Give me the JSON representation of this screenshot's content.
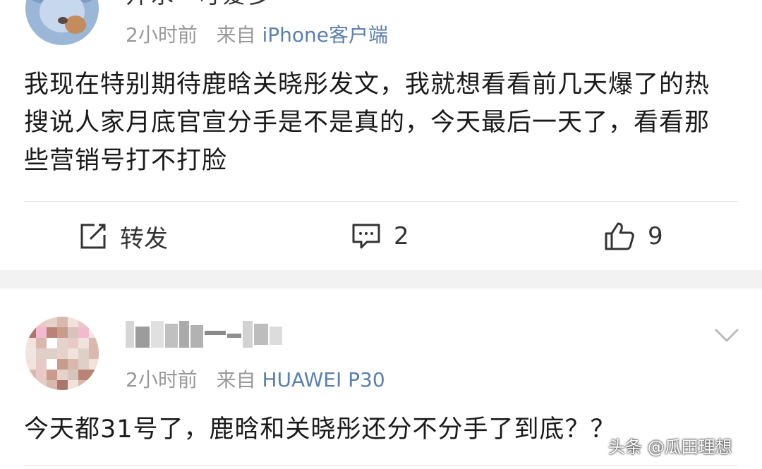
{
  "post1": {
    "username": "开水 -可爱多",
    "time": "2小时前",
    "from_label": "来自",
    "source": "iPhone客户端",
    "text": "我现在特别期待鹿晗关晓彤发文，我就想看看前几天爆了的热搜说人家月底官宣分手是不是真的，今天最后一天了，看看那些营销号打不打脸",
    "actions": {
      "repost_label": "转发",
      "comment_count": "2",
      "like_count": "9"
    }
  },
  "post2": {
    "time": "2小时前",
    "from_label": "来自",
    "source": "HUAWEI P30",
    "text": "今天都31号了，鹿晗和关晓彤还分不分手了到底？？"
  },
  "watermark": "头条 @瓜田理想",
  "icons": {
    "repost": "edit-share-icon",
    "comment": "comment-icon",
    "like": "thumbs-up-icon",
    "expand": "chevron-down-icon"
  },
  "colors": {
    "source_link": "#5a7fb0",
    "meta": "#999999",
    "separator": "#f2f2f2"
  }
}
